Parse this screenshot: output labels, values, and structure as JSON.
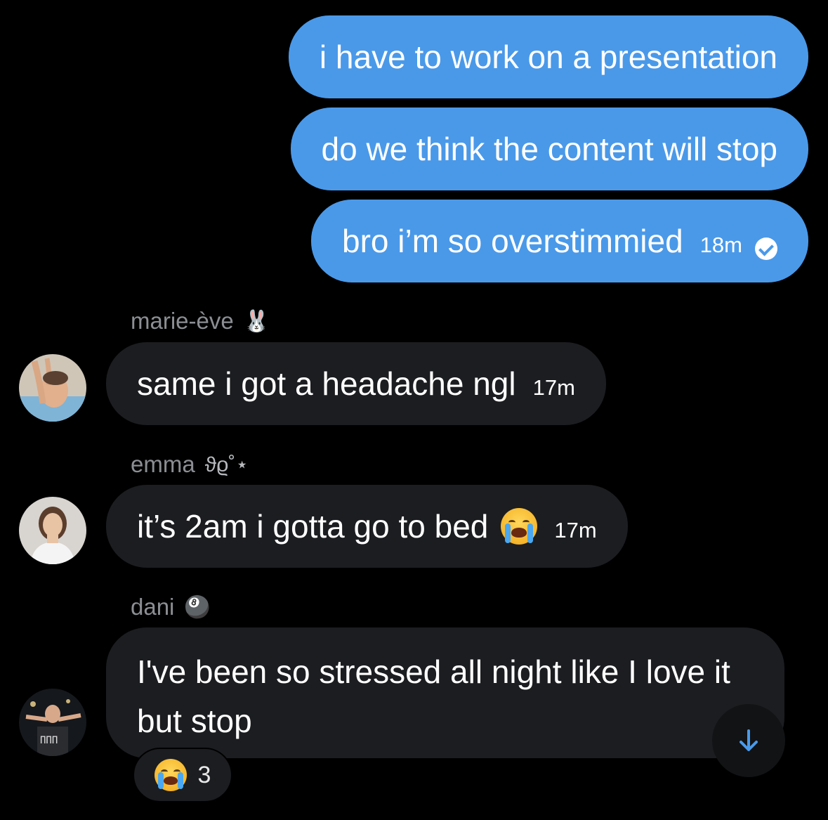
{
  "outgoing": [
    {
      "text": "i have to work on a presentation"
    },
    {
      "text": "do we think the content will stop"
    },
    {
      "text": "bro i’m so overstimmied",
      "time": "18m",
      "status_icon": "check-circle-icon"
    }
  ],
  "incoming": [
    {
      "sender": "marie-ève",
      "badge": "🐰",
      "text": "same i got a headache ngl",
      "time": "17m"
    },
    {
      "sender": "emma",
      "badge": "ϑϱ˚⋆",
      "text": "it’s 2am i gotta go to bed",
      "emoji": "loudly-crying-face",
      "time": "17m"
    },
    {
      "sender": "dani",
      "badge": "🎱",
      "text": "I've been so stressed all night like I love it but stop"
    }
  ],
  "reaction": {
    "emoji": "loudly-crying-face",
    "count": "3"
  },
  "scroll_button": {
    "icon": "arrow-down-icon"
  },
  "colors": {
    "background": "#000000",
    "outgoing_bubble": "#4a99e9",
    "incoming_bubble": "#1c1d20",
    "sender_name": "#8b8e93",
    "accent": "#4a99e9"
  }
}
